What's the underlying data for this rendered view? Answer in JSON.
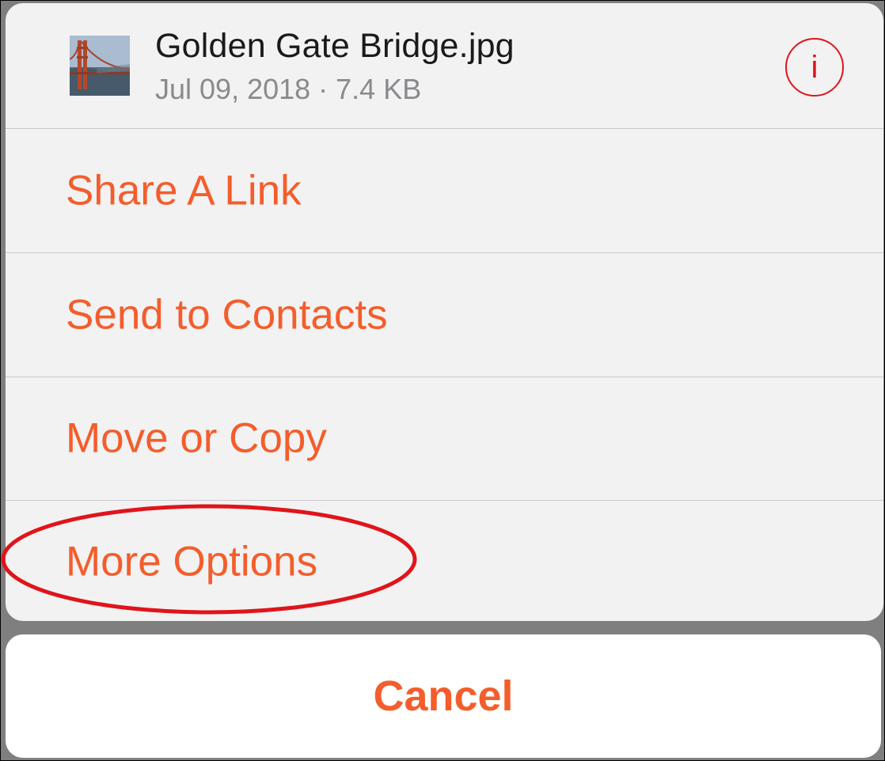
{
  "file": {
    "name": "Golden Gate Bridge.jpg",
    "meta": "Jul 09, 2018 · 7.4 KB",
    "thumbnail_icon": "golden-gate-bridge-photo"
  },
  "header": {
    "info_icon": "info-circle-icon",
    "info_glyph": "i"
  },
  "menu": {
    "items": [
      {
        "label": "Share A Link"
      },
      {
        "label": "Send to Contacts"
      },
      {
        "label": "Move or Copy"
      },
      {
        "label": "More Options"
      }
    ]
  },
  "cancel": {
    "label": "Cancel"
  },
  "annotation": {
    "type": "red-ellipse-highlight",
    "target": "More Options"
  },
  "colors": {
    "accent": "#f45d2c",
    "info_red": "#e0141b",
    "sheet_bg": "#f2f2f2",
    "separator": "#c9c9cc"
  }
}
